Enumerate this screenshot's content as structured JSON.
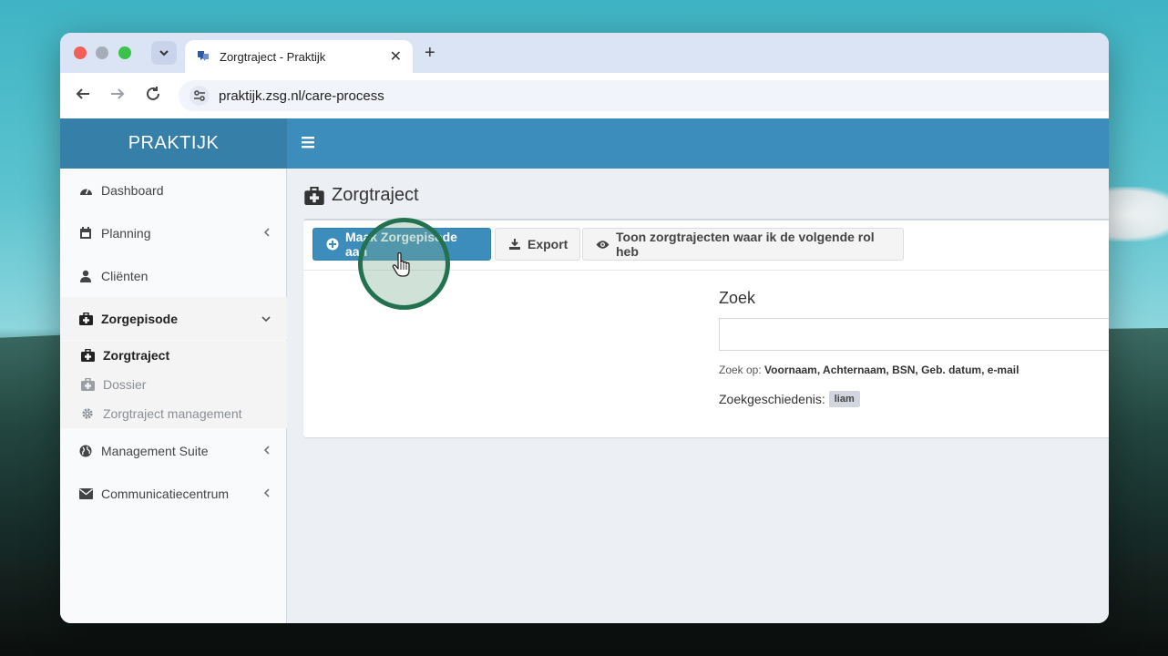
{
  "browser": {
    "tab_title": "Zorgtraject - Praktijk",
    "url": "praktijk.zsg.nl/care-process",
    "new_tab_label": "+",
    "close_label": "✕"
  },
  "app": {
    "brand": "PRAKTIJK",
    "sidebar": {
      "items": [
        {
          "label": "Dashboard"
        },
        {
          "label": "Planning"
        },
        {
          "label": "Cliënten"
        },
        {
          "label": "Zorgepisode"
        },
        {
          "label": "Management Suite"
        },
        {
          "label": "Communicatiecentrum"
        }
      ],
      "subitems": [
        {
          "label": "Zorgtraject"
        },
        {
          "label": "Dossier"
        },
        {
          "label": "Zorgtraject management"
        }
      ]
    },
    "page_title": "Zorgtraject",
    "toolbar": {
      "create_label": "Maak Zorgepisode aan",
      "export_label": "Export",
      "toon_label": "Toon zorgtrajecten waar ik de volgende rol heb"
    },
    "search": {
      "label": "Zoek",
      "placeholder": "",
      "help_prefix": "Zoek op:",
      "help_fields": "Voornaam, Achternaam, BSN, Geb. datum, e-mail",
      "history_label": "Zoekgeschiedenis:",
      "history_tag": "liam"
    }
  },
  "colors": {
    "primary": "#3c8dbc",
    "brand_bg": "#367fa9",
    "highlight_ring": "#22714f"
  }
}
